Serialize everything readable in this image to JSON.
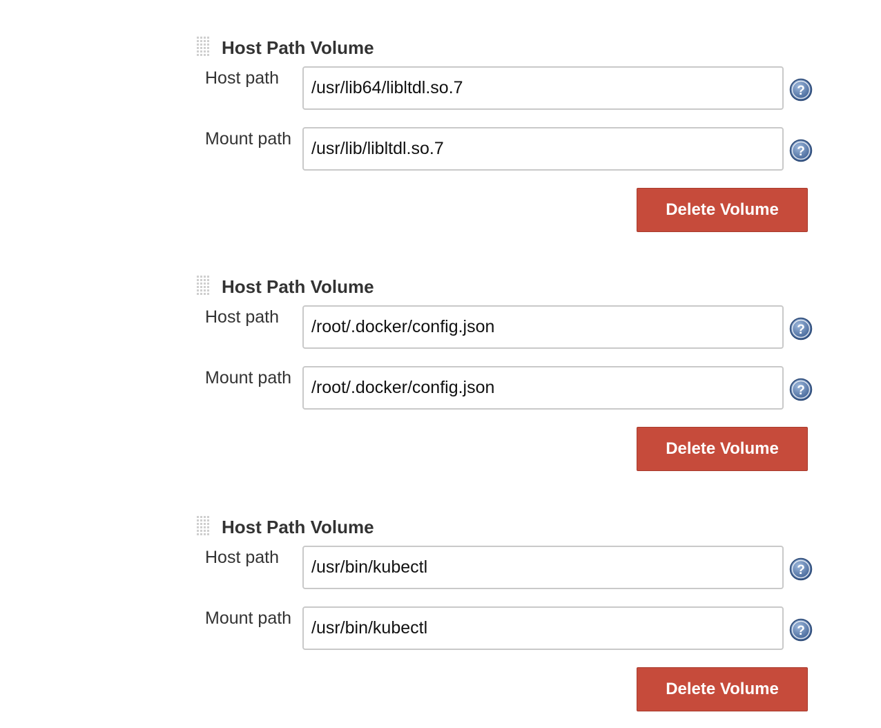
{
  "volumes": [
    {
      "title": "Host Path Volume",
      "host_path_label": "Host path",
      "host_path_value": "/usr/lib64/libltdl.so.7",
      "mount_path_label": "Mount path",
      "mount_path_value": "/usr/lib/libltdl.so.7",
      "delete_label": "Delete Volume"
    },
    {
      "title": "Host Path Volume",
      "host_path_label": "Host path",
      "host_path_value": "/root/.docker/config.json",
      "mount_path_label": "Mount path",
      "mount_path_value": "/root/.docker/config.json",
      "delete_label": "Delete Volume"
    },
    {
      "title": "Host Path Volume",
      "host_path_label": "Host path",
      "host_path_value": "/usr/bin/kubectl",
      "mount_path_label": "Mount path",
      "mount_path_value": "/usr/bin/kubectl",
      "delete_label": "Delete Volume"
    }
  ],
  "icons": {
    "drag_handle": "drag-handle-icon",
    "help": "help-question-icon"
  },
  "colors": {
    "delete_button": "#c64b3b",
    "help_icon": "#4a6fa5"
  }
}
